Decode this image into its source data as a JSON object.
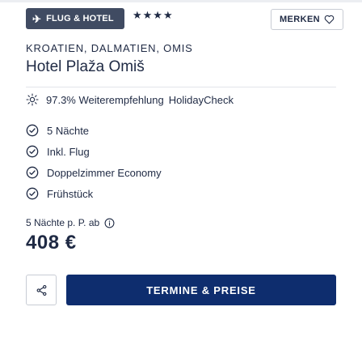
{
  "header": {
    "badge_label": "FLUG & HOTEL",
    "stars": "★★★★",
    "save_label": "MERKEN"
  },
  "hotel": {
    "region": "KROATIEN, DALMATIEN, OMIS",
    "name": "Hotel Plaža Omiš",
    "recommendation": "97.3% Weiterempfehlung",
    "rating_source": "HolidayCheck"
  },
  "features": [
    "5 Nächte",
    "Inkl. Flug",
    "Doppelzimmer Economy",
    "Frühstück"
  ],
  "pricing": {
    "duration_label": "5 Nächte p. P. ab",
    "price": "408 €"
  },
  "actions": {
    "cta_label": "TERMINE & PREISE"
  },
  "colors": {
    "badge": "#404b62",
    "primary": "#0e2d6e",
    "text": "#1f2a44"
  },
  "icons": {
    "badge": "plane-icon",
    "save": "heart-icon",
    "recommendation": "sun-icon",
    "feature": "check-circle-icon",
    "info": "info-icon",
    "share": "share-icon"
  }
}
